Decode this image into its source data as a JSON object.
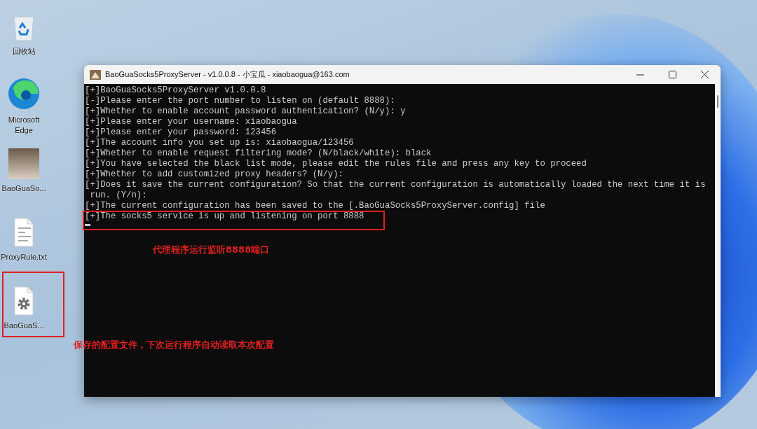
{
  "desktop_icons": [
    {
      "kind": "recycle",
      "label": "回收站"
    },
    {
      "kind": "edge",
      "label": "Microsoft Edge"
    },
    {
      "kind": "photo",
      "label": "BaoGuaSo..."
    },
    {
      "kind": "text",
      "label": "ProxyRule.txt"
    },
    {
      "kind": "config",
      "label": "BaoGuaS..."
    }
  ],
  "window": {
    "title": "BaoGuaSocks5ProxyServer - v1.0.0.8 - 小宝瓜 - xiaobaogua@163.com",
    "console_lines": [
      "[+]BaoGuaSocks5ProxyServer v1.0.0.8",
      "[-]Please enter the port number to listen on (default 8888):",
      "[+]Whether to enable account password authentication? (N/y): y",
      "[+]Please enter your username: xiaobaogua",
      "[+]Please enter your password: 123456",
      "[+]The account info you set up is: xiaobaogua/123456",
      "[+]Whether to enable request filtering mode? (N/black/white): black",
      "[+]You have selected the black list mode, please edit the rules file and press any key to proceed",
      "[+]Whether to add customized proxy headers? (N/y):",
      "[+]Does it save the current configuration? So that the current configuration is automatically loaded the next time it is",
      " run. (Y/n):",
      "[+]The current configuration has been saved to the [.BaoGuaSocks5ProxyServer.config] file",
      "[+]The socks5 service is up and listening on port 8888"
    ]
  },
  "annotations": [
    {
      "kind": "console",
      "text": "代理程序运行监听8888端口"
    },
    {
      "kind": "desktop",
      "text": "保存的配置文件，下次运行程序自动读取本次配置"
    }
  ]
}
